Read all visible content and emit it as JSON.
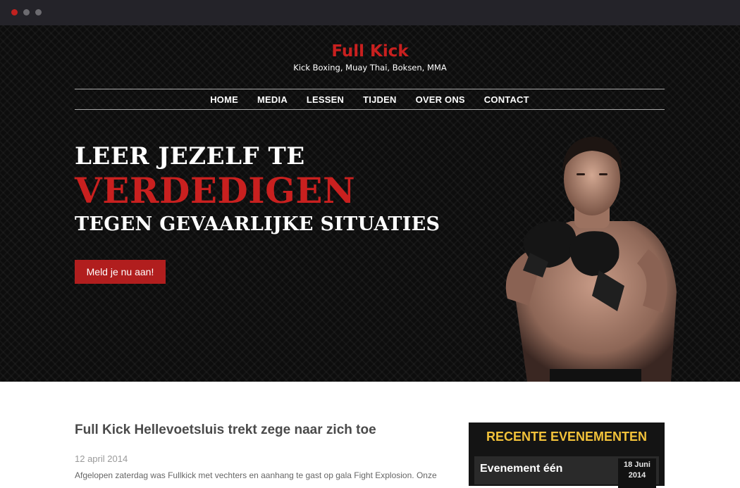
{
  "site": {
    "title": "Full Kick",
    "tagline": "Kick Boxing, Muay Thai, Boksen, MMA"
  },
  "nav": {
    "items": [
      {
        "label": "HOME"
      },
      {
        "label": "MEDIA"
      },
      {
        "label": "LESSEN"
      },
      {
        "label": "TIJDEN"
      },
      {
        "label": "OVER ONS"
      },
      {
        "label": "CONTACT"
      }
    ]
  },
  "hero": {
    "line1": "LEER JEZELF TE",
    "line2": "VERDEDIGEN",
    "line3": "TEGEN GEVAARLIJKE SITUATIES",
    "cta_label": "Meld je nu aan!"
  },
  "post": {
    "title": "Full Kick Hellevoetsluis trekt zege naar zich toe",
    "date": "12 april 2014",
    "excerpt": "Afgelopen zaterdag was Fullkick met vechters en aanhang te gast op gala Fight Explosion. Onze"
  },
  "sidebar": {
    "events_title": "RECENTE EVENEMENTEN",
    "events": [
      {
        "name": "Evenement één",
        "date_day": "18 Juni",
        "date_year": "2014"
      }
    ]
  },
  "colors": {
    "accent_red": "#c9201f",
    "button_red": "#b11e1e",
    "events_yellow": "#f2c23a",
    "hero_bg": "#0d0d0d"
  }
}
